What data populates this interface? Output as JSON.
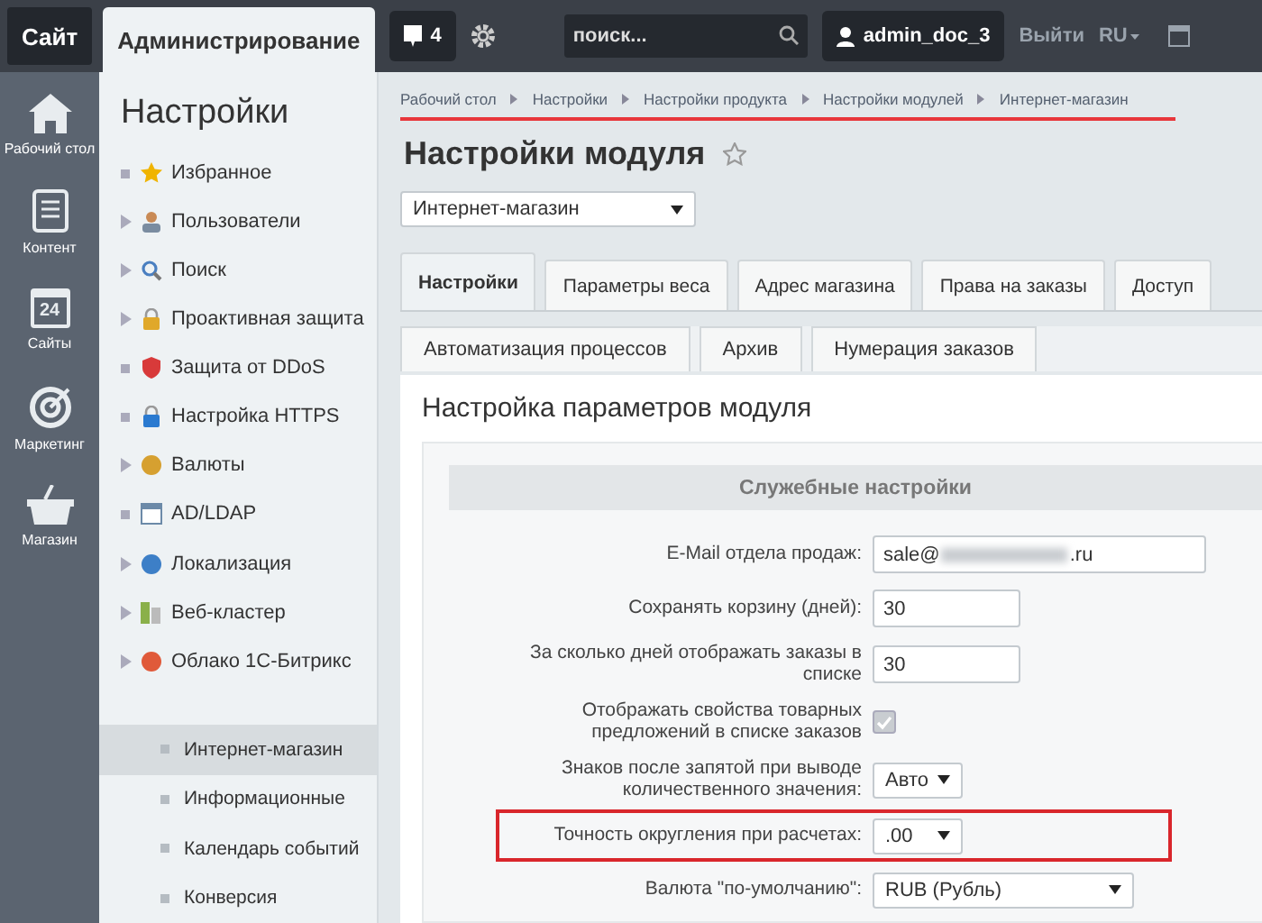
{
  "topbar": {
    "site_button": "Сайт",
    "admin_tab": "Администрирование",
    "notifications": "4",
    "search": {
      "placeholder": "поиск..."
    },
    "user": "admin_doc_3",
    "logout": "Выйти",
    "language": "RU"
  },
  "rail": [
    {
      "label": "Рабочий стол",
      "kind": "home"
    },
    {
      "label": "Контент",
      "kind": "document"
    },
    {
      "label": "Сайты",
      "kind": "calendar",
      "icon_text": "24"
    },
    {
      "label": "Маркетинг",
      "kind": "target"
    },
    {
      "label": "Магазин",
      "kind": "basket"
    }
  ],
  "sidebar": {
    "title": "Настройки",
    "items": [
      {
        "label": "Избранное",
        "kind": "bullet"
      },
      {
        "label": "Пользователи",
        "kind": "arrow"
      },
      {
        "label": "Поиск",
        "kind": "arrow"
      },
      {
        "label": "Проактивная защита",
        "kind": "arrow"
      },
      {
        "label": "Защита от DDoS",
        "kind": "bullet"
      },
      {
        "label": "Настройка HTTPS",
        "kind": "bullet"
      },
      {
        "label": "Валюты",
        "kind": "arrow"
      },
      {
        "label": "AD/LDAP",
        "kind": "bullet"
      },
      {
        "label": "Локализация",
        "kind": "arrow"
      },
      {
        "label": "Веб-кластер",
        "kind": "arrow"
      },
      {
        "label": "Облако 1С-Битрикс",
        "kind": "arrow"
      }
    ],
    "sub_items": [
      {
        "label": "Интернет-магазин",
        "selected": true
      },
      {
        "label": "Информационные",
        "selected": false
      },
      {
        "label": "Календарь событий",
        "selected": false
      },
      {
        "label": "Конверсия",
        "selected": false
      }
    ]
  },
  "breadcrumbs": [
    "Рабочий стол",
    "Настройки",
    "Настройки продукта",
    "Настройки модулей",
    "Интернет-магазин"
  ],
  "page_title": "Настройки модуля",
  "module_select": "Интернет-магазин",
  "tabs": [
    {
      "label": "Настройки",
      "selected": true
    },
    {
      "label": "Параметры веса",
      "selected": false
    },
    {
      "label": "Адрес магазина",
      "selected": false
    },
    {
      "label": "Права на заказы",
      "selected": false
    },
    {
      "label": "Доступ",
      "selected": false
    }
  ],
  "subtabs": [
    "Автоматизация процессов",
    "Архив",
    "Нумерация заказов"
  ],
  "panel": {
    "title": "Настройка параметров модуля",
    "section": "Служебные настройки",
    "rows": [
      {
        "label": "E-Mail отдела продаж:",
        "kind": "email",
        "value": "sale@",
        "value_end": ".ru",
        "highlighted": false
      },
      {
        "label": "Сохранять корзину (дней):",
        "kind": "text",
        "value": "30",
        "highlighted": false
      },
      {
        "label": "За сколько дней отображать заказы в списке",
        "kind": "text",
        "value": "30",
        "highlighted": false
      },
      {
        "label": "Отображать свойства товарных предложений в списке заказов",
        "kind": "checkbox",
        "checked": true,
        "highlighted": false
      },
      {
        "label": "Знаков после запятой при выводе количественного значения:",
        "kind": "select",
        "value": "Авто",
        "highlighted": false
      },
      {
        "label": "Точность округления при расчетах:",
        "kind": "select",
        "value": ".00",
        "highlighted": true
      },
      {
        "label": "Валюта \"по-умолчанию\":",
        "kind": "wide_select",
        "value": "RUB (Рубль)",
        "highlighted": false
      }
    ]
  }
}
